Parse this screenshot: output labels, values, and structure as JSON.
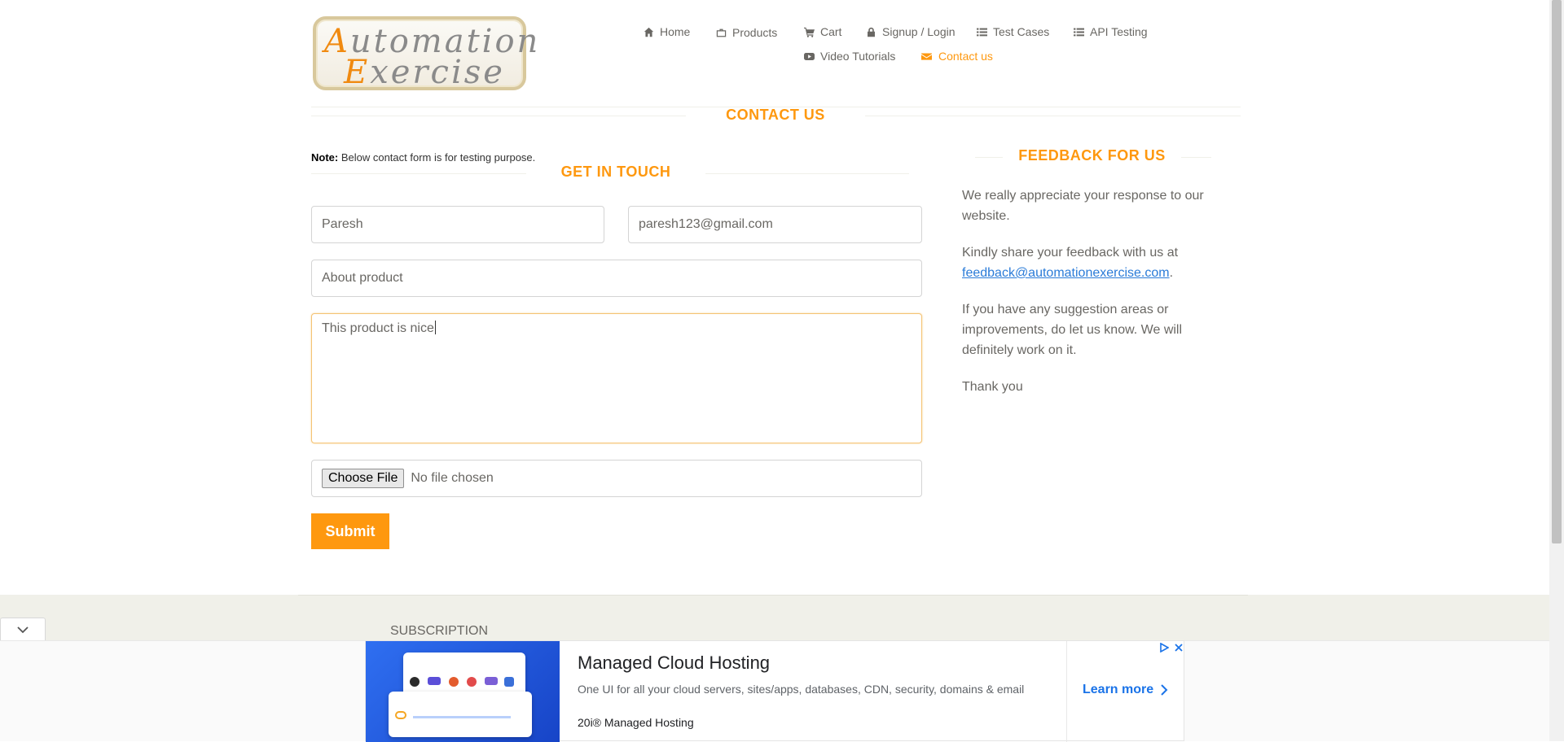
{
  "logo": {
    "line1_cap": "A",
    "line1_rest": "utomation",
    "line2_cap": "E",
    "line2_rest": "xercise"
  },
  "nav": {
    "items": [
      {
        "label": "Home",
        "icon": "home-icon"
      },
      {
        "label": "Products",
        "icon": "briefcase-icon"
      },
      {
        "label": "Cart",
        "icon": "cart-icon"
      },
      {
        "label": "Signup / Login",
        "icon": "lock-icon"
      },
      {
        "label": "Test Cases",
        "icon": "list-icon"
      },
      {
        "label": "API Testing",
        "icon": "list-icon"
      },
      {
        "label": "Video Tutorials",
        "icon": "youtube-icon"
      },
      {
        "label": "Contact us",
        "icon": "envelope-icon"
      }
    ],
    "active_index": 7
  },
  "contact": {
    "title": "Contact Us",
    "note_label": "Note:",
    "note_text": " Below contact form is for testing purpose.",
    "get_in_touch": "Get In Touch",
    "form": {
      "name_value": "Paresh",
      "email_value": "paresh123@gmail.com",
      "subject_value": "About product",
      "message_value": "This product is nice",
      "file_button": "Choose File",
      "file_status": "No file chosen",
      "submit_label": "Submit"
    }
  },
  "feedback": {
    "title": "Feedback For Us",
    "p1": "We really appreciate your response to our website.",
    "p2_prefix": "Kindly share your feedback with us at",
    "p2_email": "feedback@automationexercise.com",
    "p2_suffix": ".",
    "p3": "If you have any suggestion areas or improvements, do let us know. We will definitely work on it.",
    "p4": "Thank you"
  },
  "footer": {
    "subscription_title": "Subscription"
  },
  "ad": {
    "title": "Managed Cloud Hosting",
    "description": "One UI for all your cloud servers, sites/apps, databases, CDN, security, domains & email",
    "brand": "20i® Managed Hosting",
    "cta": "Learn more"
  },
  "colors": {
    "accent": "#fe980f",
    "text": "#696763",
    "link": "#2a7bd8",
    "footer_bg": "#f0f0e9"
  }
}
